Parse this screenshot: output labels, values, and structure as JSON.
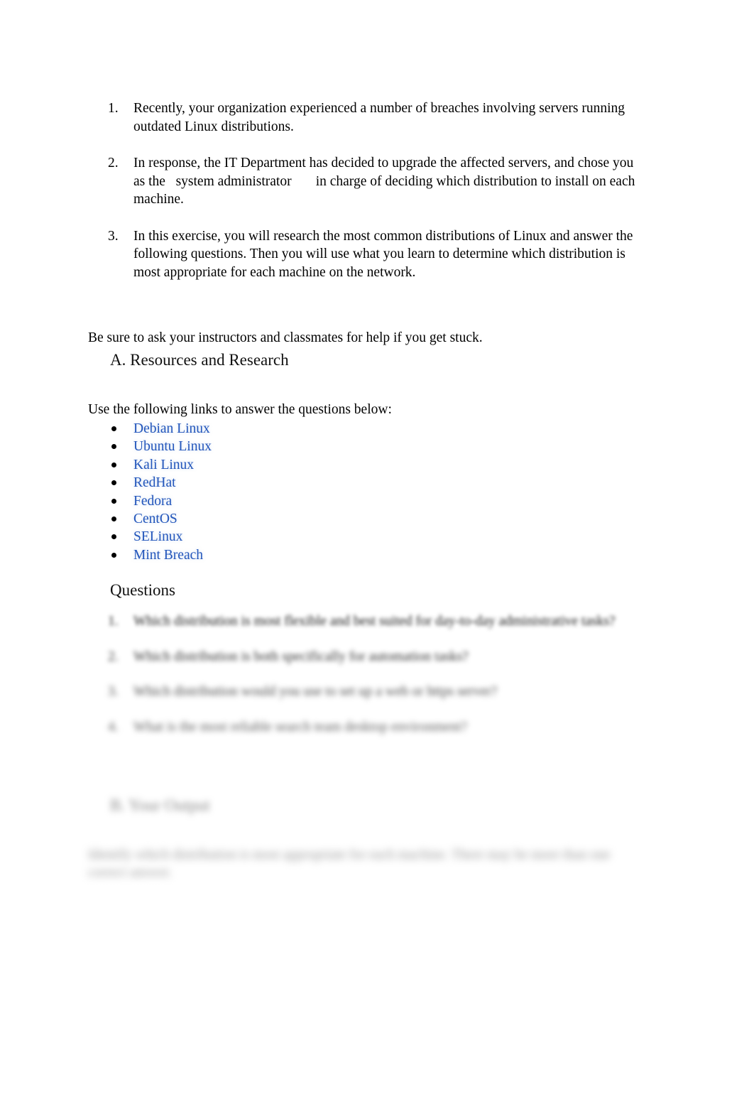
{
  "document": {
    "intro_list": [
      {
        "marker": "1.",
        "text": "Recently, your organization experienced a number of breaches involving servers running outdated Linux distributions."
      },
      {
        "marker": "2.",
        "text": "In response, the IT Department has decided to upgrade the affected servers, and chose you as the   system administrator       in charge of deciding which distribution to install on each machine."
      },
      {
        "marker": "3.",
        "text": "In this exercise, you will research the most common distributions of Linux and answer the following questions. Then you will use what you learn to determine which distribution is most appropriate for each machine on the network."
      }
    ],
    "help_paragraph": "Be sure to ask your instructors and classmates for help if you get stuck.",
    "section_a": {
      "heading": "A. Resources and Research",
      "links_intro": "Use the following links to answer the questions below:",
      "links": [
        {
          "label": "Debian Linux"
        },
        {
          "label": "Ubuntu Linux"
        },
        {
          "label": "Kali Linux"
        },
        {
          "label": "RedHat"
        },
        {
          "label": "Fedora"
        },
        {
          "label": "CentOS"
        },
        {
          "label": "SELinux"
        },
        {
          "label": "Mint Breach"
        }
      ],
      "link_color": "#2255bb"
    },
    "questions_section": {
      "heading": "Questions",
      "items": [
        {
          "marker": "1.",
          "text": "Which distribution is most flexible and best suited for day-to-day administrative tasks?"
        },
        {
          "marker": "2.",
          "text": "Which distribution is both specifically for automation tasks?"
        },
        {
          "marker": "3.",
          "text": "Which distribution would you use to set up a web or https server?"
        },
        {
          "marker": "4.",
          "text": "What is the most reliable search team desktop environment?"
        }
      ]
    },
    "section_b": {
      "heading": "B. Your Output",
      "paragraph": "Identify which distribution is most appropriate for each machine. There may be more than one correct answer."
    }
  }
}
